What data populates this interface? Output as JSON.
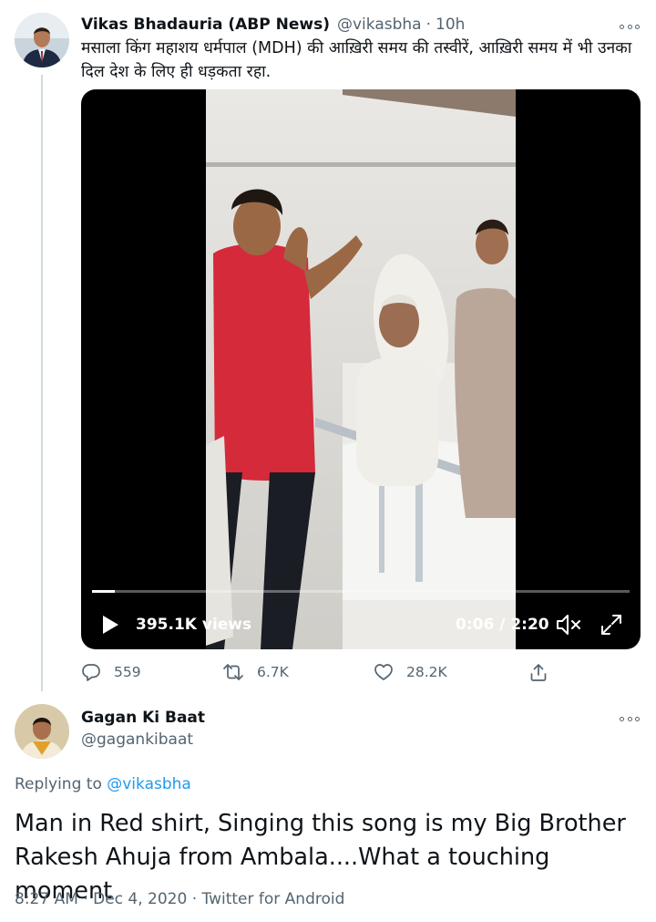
{
  "tweet1": {
    "name": "Vikas Bhadauria (ABP News)",
    "handle": "@vikasbha",
    "separator": "·",
    "time": "10h",
    "text": "मसाला किंग महाशय धर्मपाल (MDH) की आख़िरी समय की तस्वीरें, आख़िरी समय में भी उनका दिल देश के लिए ही धड़कता रहा.",
    "video": {
      "views": "395.1K views",
      "elapsed": "0:06",
      "time_separator": " / ",
      "duration": "2:20",
      "progress_fraction": 0.043
    },
    "actions": {
      "replies": "559",
      "retweets": "6.7K",
      "likes": "28.2K"
    }
  },
  "tweet2": {
    "name": "Gagan Ki Baat",
    "handle": "@gagankibaat",
    "replying_prefix": "Replying to ",
    "replying_to": "@vikasbha",
    "text": "Man in Red shirt, Singing this song is my Big Brother Rakesh Ahuja from Ambala....What a touching moment",
    "timestamp": "8:27 AM",
    "date": "Dec 4, 2020",
    "source": "Twitter for Android",
    "separator": " · "
  },
  "icons": [
    "more-icon",
    "play-icon",
    "volume-muted-icon",
    "fullscreen-icon",
    "reply-icon",
    "retweet-icon",
    "like-icon",
    "share-icon"
  ],
  "colors": {
    "text": "#0f1419",
    "secondary": "#536471",
    "link": "#1d9bf0",
    "thread_line": "#cfd9de",
    "shirt_red": "#d42a3a"
  }
}
